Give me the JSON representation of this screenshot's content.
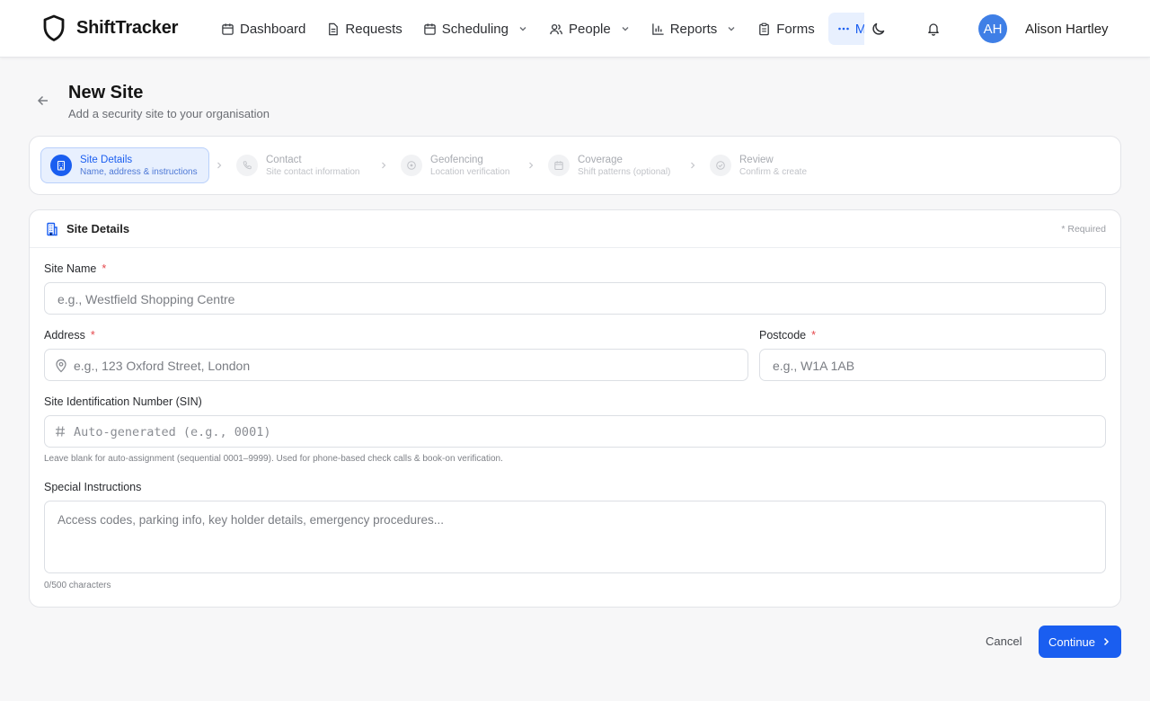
{
  "app": {
    "name": "ShiftTracker"
  },
  "nav": {
    "items": [
      {
        "label": "Dashboard",
        "icon": "calendar-icon"
      },
      {
        "label": "Requests",
        "icon": "document-icon"
      },
      {
        "label": "Scheduling",
        "icon": "calendar-icon",
        "dropdown": true
      },
      {
        "label": "People",
        "icon": "users-icon",
        "dropdown": true
      },
      {
        "label": "Reports",
        "icon": "bar-chart-icon",
        "dropdown": true
      },
      {
        "label": "Forms",
        "icon": "clipboard-icon"
      }
    ],
    "more_label": "More"
  },
  "user": {
    "initials": "AH",
    "name": "Alison Hartley"
  },
  "header": {
    "title": "New Site",
    "subtitle": "Add a security site to your organisation"
  },
  "stepper": {
    "steps": [
      {
        "title": "Site Details",
        "subtitle": "Name, address & instructions",
        "icon": "building-icon",
        "active": true
      },
      {
        "title": "Contact",
        "subtitle": "Site contact information",
        "icon": "phone-icon"
      },
      {
        "title": "Geofencing",
        "subtitle": "Location verification",
        "icon": "target-icon"
      },
      {
        "title": "Coverage",
        "subtitle": "Shift patterns (optional)",
        "icon": "calendar-icon"
      },
      {
        "title": "Review",
        "subtitle": "Confirm & create",
        "icon": "check-circle-icon"
      }
    ]
  },
  "form": {
    "title": "Site Details",
    "required_note": "* Required",
    "required_mark": "*",
    "site_name": {
      "label": "Site Name",
      "placeholder": "e.g., Westfield Shopping Centre"
    },
    "address": {
      "label": "Address",
      "placeholder": "e.g., 123 Oxford Street, London"
    },
    "postcode": {
      "label": "Postcode",
      "placeholder": "e.g., W1A 1AB"
    },
    "sin": {
      "label": "Site Identification Number (SIN)",
      "placeholder": "Auto-generated (e.g., 0001)",
      "hint": "Leave blank for auto-assignment (sequential 0001–9999). Used for phone-based check calls & book-on verification."
    },
    "instructions": {
      "label": "Special Instructions",
      "placeholder": "Access codes, parking info, key holder details, emergency procedures...",
      "counter": "0/500 characters"
    }
  },
  "actions": {
    "cancel": "Cancel",
    "continue": "Continue"
  },
  "colors": {
    "accent": "#1a5ef0",
    "required": "#e5484d",
    "avatar": "#3f7fe6"
  }
}
